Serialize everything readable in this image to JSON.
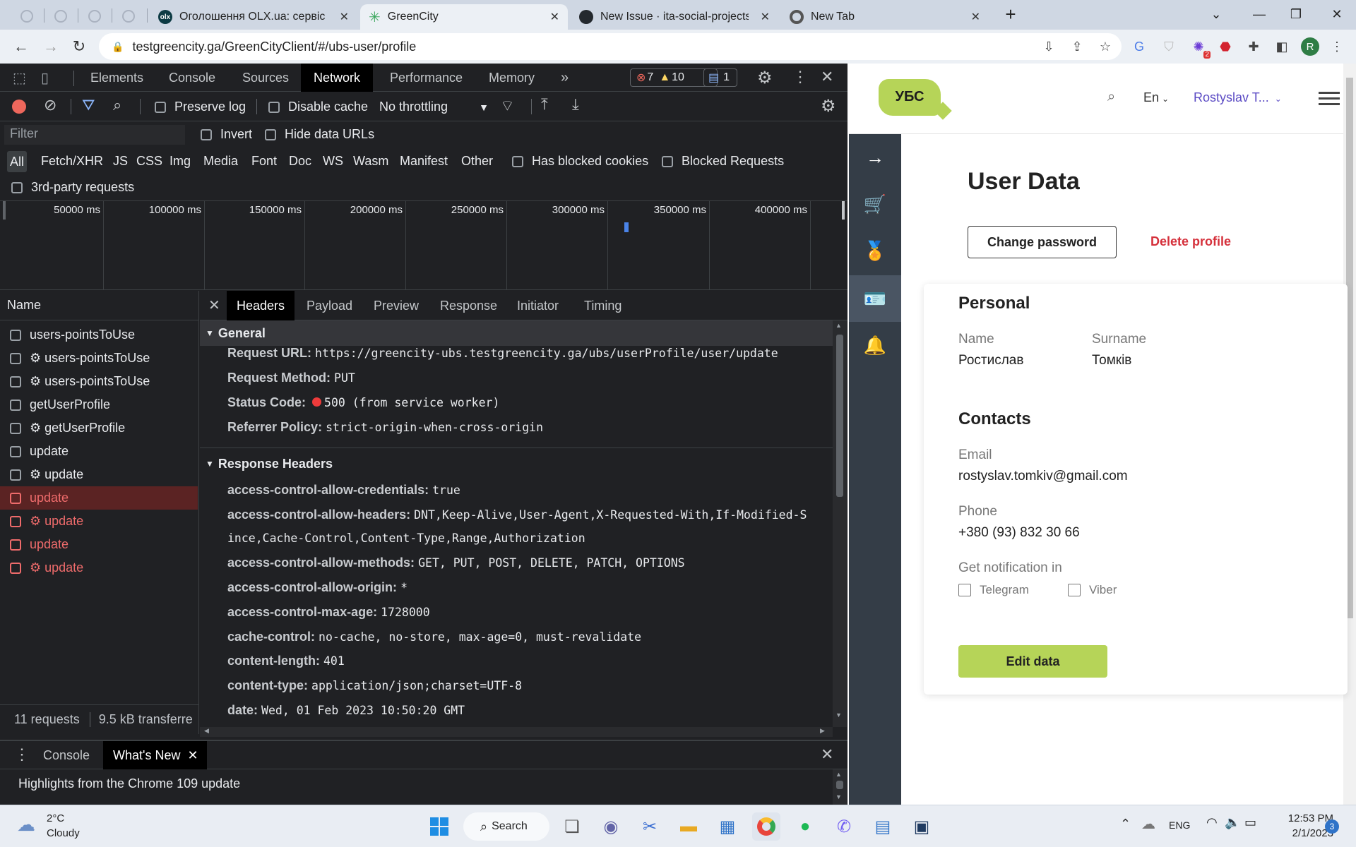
{
  "browser": {
    "tabs": [
      {
        "label": "Оголошення OLX.ua: сервіс ого",
        "icon": "olx-icon"
      },
      {
        "label": "GreenCity",
        "icon": "greencity-icon",
        "active": true
      },
      {
        "label": "New Issue · ita-social-projects/Gr",
        "icon": "github-icon"
      },
      {
        "label": "New Tab",
        "icon": "chrome-icon"
      }
    ],
    "url": "testgreencity.ga/GreenCityClient/#/ubs-user/profile",
    "extension_badge": "2",
    "profile_initial": "R"
  },
  "devtools": {
    "tabs": [
      "Elements",
      "Console",
      "Sources",
      "Network",
      "Performance",
      "Memory"
    ],
    "selected_tab": "Network",
    "errors_count": "7",
    "warnings_count": "10",
    "messages_count": "1",
    "toolbar": {
      "preserve_log": "Preserve log",
      "disable_cache": "Disable cache",
      "throttling": "No throttling"
    },
    "filter": {
      "placeholder": "Filter",
      "invert": "Invert",
      "hide_data_urls": "Hide data URLs",
      "types": [
        "All",
        "Fetch/XHR",
        "JS",
        "CSS",
        "Img",
        "Media",
        "Font",
        "Doc",
        "WS",
        "Wasm",
        "Manifest",
        "Other"
      ],
      "has_blocked_cookies": "Has blocked cookies",
      "blocked_requests": "Blocked Requests",
      "third_party": "3rd-party requests"
    },
    "timeline_labels": [
      "50000 ms",
      "100000 ms",
      "150000 ms",
      "200000 ms",
      "250000 ms",
      "300000 ms",
      "350000 ms",
      "400000 ms"
    ],
    "requests_header": "Name",
    "requests": [
      {
        "name": "users-pointsToUse",
        "status": "ok"
      },
      {
        "name": "⚙ users-pointsToUse",
        "status": "ok"
      },
      {
        "name": "⚙ users-pointsToUse",
        "status": "ok"
      },
      {
        "name": "getUserProfile",
        "status": "ok"
      },
      {
        "name": "⚙ getUserProfile",
        "status": "ok"
      },
      {
        "name": "update",
        "status": "ok"
      },
      {
        "name": "⚙ update",
        "status": "ok"
      },
      {
        "name": "update",
        "status": "error-selected"
      },
      {
        "name": "⚙ update",
        "status": "error"
      },
      {
        "name": "update",
        "status": "error"
      },
      {
        "name": "⚙ update",
        "status": "error"
      }
    ],
    "summary": {
      "requests": "11 requests",
      "transferred": "9.5 kB transferre"
    },
    "detail_tabs": [
      "Headers",
      "Payload",
      "Preview",
      "Response",
      "Initiator",
      "Timing"
    ],
    "general_title": "General",
    "general": [
      {
        "key": "Request URL:",
        "value": "https://greencity-ubs.testgreencity.ga/ubs/userProfile/user/update"
      },
      {
        "key": "Request Method:",
        "value": "PUT"
      },
      {
        "key": "Status Code:",
        "value": "500  (from service worker)"
      },
      {
        "key": "Referrer Policy:",
        "value": "strict-origin-when-cross-origin"
      }
    ],
    "response_title": "Response Headers",
    "response_headers": [
      {
        "key": "access-control-allow-credentials:",
        "value": "true"
      },
      {
        "key": "access-control-allow-headers:",
        "value": "DNT,Keep-Alive,User-Agent,X-Requested-With,If-Modified-S"
      },
      {
        "key": "",
        "value": "ince,Cache-Control,Content-Type,Range,Authorization"
      },
      {
        "key": "access-control-allow-methods:",
        "value": "GET, PUT, POST, DELETE, PATCH, OPTIONS"
      },
      {
        "key": "access-control-allow-origin:",
        "value": "*"
      },
      {
        "key": "access-control-max-age:",
        "value": "1728000"
      },
      {
        "key": "cache-control:",
        "value": "no-cache, no-store, max-age=0, must-revalidate"
      },
      {
        "key": "content-length:",
        "value": "401"
      },
      {
        "key": "content-type:",
        "value": "application/json;charset=UTF-8"
      },
      {
        "key": "date:",
        "value": "Wed, 01 Feb 2023 10:50:20 GMT"
      }
    ],
    "drawer": {
      "tabs": [
        "Console",
        "What's New"
      ],
      "message": "Highlights from the Chrome 109 update"
    }
  },
  "page": {
    "logo": "УБС",
    "language": "En",
    "user_name": "Rostyslav T...",
    "title": "User Data",
    "change_password": "Change password",
    "delete_profile": "Delete profile",
    "personal_title": "Personal",
    "name_label": "Name",
    "name_value": "Ростислав",
    "surname_label": "Surname",
    "surname_value": "Томків",
    "contacts_title": "Contacts",
    "email_label": "Email",
    "email_value": "rostyslav.tomkiv@gmail.com",
    "phone_label": "Phone",
    "phone_value": "+380 (93) 832 30 66",
    "notification_label": "Get notification in",
    "telegram": "Telegram",
    "viber": "Viber",
    "edit_button": "Edit data",
    "colors": {
      "accent_green": "#b6d458",
      "delete_red": "#d5303b",
      "sidebar": "#343d47",
      "link_purple": "#5b4bc4"
    }
  },
  "taskbar": {
    "weather_temp": "2°C",
    "weather_desc": "Cloudy",
    "search": "Search",
    "language": "ENG",
    "time": "12:53 PM",
    "date": "2/1/2023",
    "notifications": "3"
  }
}
